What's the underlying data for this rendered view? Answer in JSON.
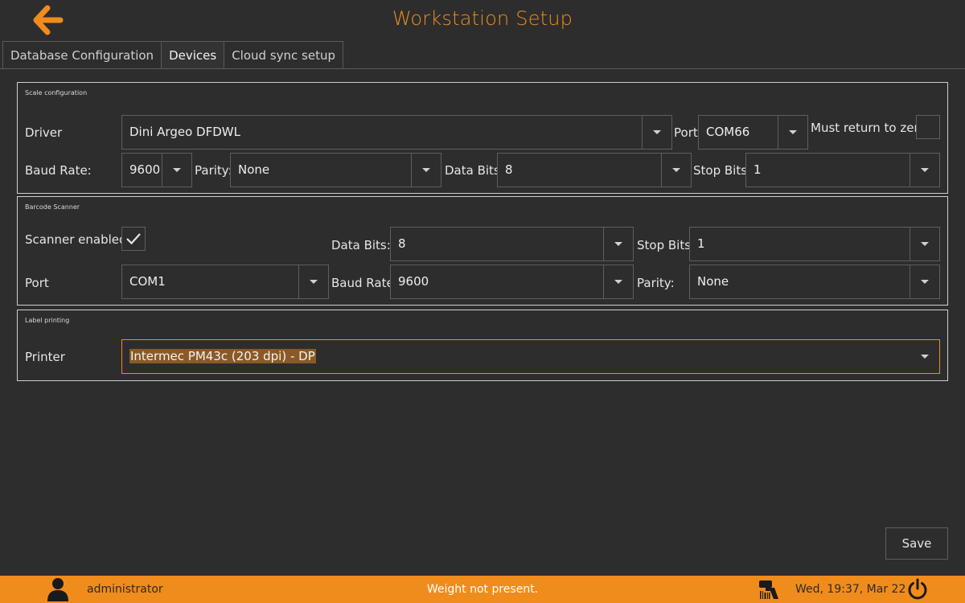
{
  "header": {
    "title": "Workstation Setup",
    "back_icon": "arrow-left-icon",
    "accent_color": "#f08c1c"
  },
  "tabs": [
    {
      "label": "Database Configuration",
      "active": false
    },
    {
      "label": "Devices",
      "active": true
    },
    {
      "label": "Cloud sync setup",
      "active": false
    }
  ],
  "scale": {
    "title": "Scale configuration",
    "driver_label": "Driver",
    "driver_value": "Dini Argeo DFDWL",
    "port_label": "Port",
    "port_value": "COM66",
    "must_return_label": "Must return to zero",
    "must_return_checked": false,
    "baud_label": "Baud Rate:",
    "baud_value": "9600",
    "parity_label": "Parity:",
    "parity_value": "None",
    "databits_label": "Data Bits:",
    "databits_value": "8",
    "stopbits_label": "Stop Bits:",
    "stopbits_value": "1"
  },
  "scanner": {
    "title": "Barcode Scanner",
    "enabled_label": "Scanner enabled:",
    "enabled_checked": true,
    "databits_label": "Data Bits:",
    "databits_value": "8",
    "stopbits_label": "Stop Bits:",
    "stopbits_value": "1",
    "port_label": "Port",
    "port_value": "COM1",
    "baud_label": "Baud Rate:",
    "baud_value": "9600",
    "parity_label": "Parity:",
    "parity_value": "None"
  },
  "label_printing": {
    "title": "Label printing",
    "printer_label": "Printer",
    "printer_value": "Intermec PM43c (203 dpi) - DP"
  },
  "actions": {
    "save_label": "Save"
  },
  "status_bar": {
    "user_icon": "user-icon",
    "user_name": "administrator",
    "message": "Weight not present.",
    "scanner_icon": "barcode-scanner-icon",
    "datetime": "Wed, 19:37, Mar 22",
    "power_icon": "power-icon"
  }
}
